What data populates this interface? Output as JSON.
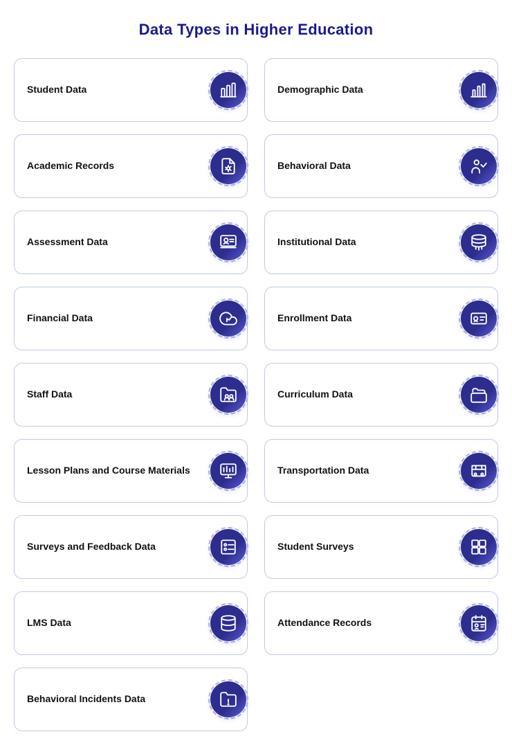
{
  "title": "Data Types in Higher Education",
  "items": [
    {
      "id": "student-data",
      "label": "Student Data",
      "icon": "bar-chart",
      "col": 1
    },
    {
      "id": "demographic-data",
      "label": "Demographic Data",
      "icon": "bar-chart2",
      "col": 2
    },
    {
      "id": "academic-records",
      "label": "Academic Records",
      "icon": "file-settings",
      "col": 1
    },
    {
      "id": "behavioral-data",
      "label": "Behavioral Data",
      "icon": "person-chart",
      "col": 2
    },
    {
      "id": "assessment-data",
      "label": "Assessment Data",
      "icon": "person-board",
      "col": 1
    },
    {
      "id": "institutional-data",
      "label": "Institutional Data",
      "icon": "database",
      "col": 2
    },
    {
      "id": "financial-data",
      "label": "Financial Data",
      "icon": "cloud-chart",
      "col": 1
    },
    {
      "id": "enrollment-data",
      "label": "Enrollment Data",
      "icon": "id-card",
      "col": 2
    },
    {
      "id": "staff-data",
      "label": "Staff Data",
      "icon": "folder-people",
      "col": 1
    },
    {
      "id": "curriculum-data",
      "label": "Curriculum Data",
      "icon": "folders",
      "col": 2
    },
    {
      "id": "lesson-plans",
      "label": "Lesson Plans and Course Materials",
      "icon": "presentation",
      "col": 1
    },
    {
      "id": "transportation-data",
      "label": "Transportation Data",
      "icon": "bus",
      "col": 2
    },
    {
      "id": "surveys-feedback",
      "label": "Surveys and Feedback Data",
      "icon": "survey",
      "col": 1
    },
    {
      "id": "student-surveys",
      "label": "Student Surveys",
      "icon": "grid-list",
      "col": 2
    },
    {
      "id": "lms-data",
      "label": "LMS Data",
      "icon": "database2",
      "col": 1
    },
    {
      "id": "attendance-records",
      "label": "Attendance Records",
      "icon": "attendance",
      "col": 2
    },
    {
      "id": "behavioral-incidents",
      "label": "Behavioral Incidents Data",
      "icon": "folder-warning",
      "col": 1
    }
  ]
}
